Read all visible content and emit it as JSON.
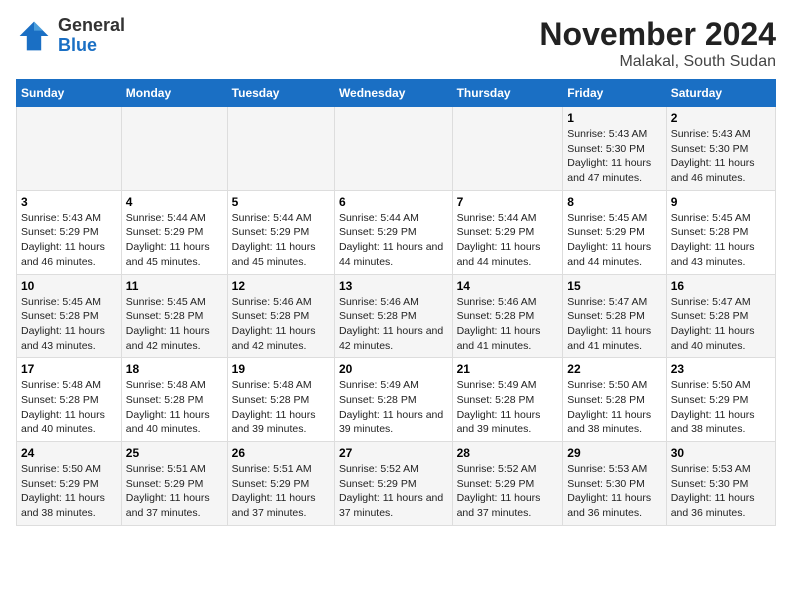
{
  "header": {
    "logo_general": "General",
    "logo_blue": "Blue",
    "title": "November 2024",
    "subtitle": "Malakal, South Sudan"
  },
  "days_of_week": [
    "Sunday",
    "Monday",
    "Tuesday",
    "Wednesday",
    "Thursday",
    "Friday",
    "Saturday"
  ],
  "weeks": [
    [
      {
        "day": "",
        "info": ""
      },
      {
        "day": "",
        "info": ""
      },
      {
        "day": "",
        "info": ""
      },
      {
        "day": "",
        "info": ""
      },
      {
        "day": "",
        "info": ""
      },
      {
        "day": "1",
        "info": "Sunrise: 5:43 AM\nSunset: 5:30 PM\nDaylight: 11 hours and 47 minutes."
      },
      {
        "day": "2",
        "info": "Sunrise: 5:43 AM\nSunset: 5:30 PM\nDaylight: 11 hours and 46 minutes."
      }
    ],
    [
      {
        "day": "3",
        "info": "Sunrise: 5:43 AM\nSunset: 5:29 PM\nDaylight: 11 hours and 46 minutes."
      },
      {
        "day": "4",
        "info": "Sunrise: 5:44 AM\nSunset: 5:29 PM\nDaylight: 11 hours and 45 minutes."
      },
      {
        "day": "5",
        "info": "Sunrise: 5:44 AM\nSunset: 5:29 PM\nDaylight: 11 hours and 45 minutes."
      },
      {
        "day": "6",
        "info": "Sunrise: 5:44 AM\nSunset: 5:29 PM\nDaylight: 11 hours and 44 minutes."
      },
      {
        "day": "7",
        "info": "Sunrise: 5:44 AM\nSunset: 5:29 PM\nDaylight: 11 hours and 44 minutes."
      },
      {
        "day": "8",
        "info": "Sunrise: 5:45 AM\nSunset: 5:29 PM\nDaylight: 11 hours and 44 minutes."
      },
      {
        "day": "9",
        "info": "Sunrise: 5:45 AM\nSunset: 5:28 PM\nDaylight: 11 hours and 43 minutes."
      }
    ],
    [
      {
        "day": "10",
        "info": "Sunrise: 5:45 AM\nSunset: 5:28 PM\nDaylight: 11 hours and 43 minutes."
      },
      {
        "day": "11",
        "info": "Sunrise: 5:45 AM\nSunset: 5:28 PM\nDaylight: 11 hours and 42 minutes."
      },
      {
        "day": "12",
        "info": "Sunrise: 5:46 AM\nSunset: 5:28 PM\nDaylight: 11 hours and 42 minutes."
      },
      {
        "day": "13",
        "info": "Sunrise: 5:46 AM\nSunset: 5:28 PM\nDaylight: 11 hours and 42 minutes."
      },
      {
        "day": "14",
        "info": "Sunrise: 5:46 AM\nSunset: 5:28 PM\nDaylight: 11 hours and 41 minutes."
      },
      {
        "day": "15",
        "info": "Sunrise: 5:47 AM\nSunset: 5:28 PM\nDaylight: 11 hours and 41 minutes."
      },
      {
        "day": "16",
        "info": "Sunrise: 5:47 AM\nSunset: 5:28 PM\nDaylight: 11 hours and 40 minutes."
      }
    ],
    [
      {
        "day": "17",
        "info": "Sunrise: 5:48 AM\nSunset: 5:28 PM\nDaylight: 11 hours and 40 minutes."
      },
      {
        "day": "18",
        "info": "Sunrise: 5:48 AM\nSunset: 5:28 PM\nDaylight: 11 hours and 40 minutes."
      },
      {
        "day": "19",
        "info": "Sunrise: 5:48 AM\nSunset: 5:28 PM\nDaylight: 11 hours and 39 minutes."
      },
      {
        "day": "20",
        "info": "Sunrise: 5:49 AM\nSunset: 5:28 PM\nDaylight: 11 hours and 39 minutes."
      },
      {
        "day": "21",
        "info": "Sunrise: 5:49 AM\nSunset: 5:28 PM\nDaylight: 11 hours and 39 minutes."
      },
      {
        "day": "22",
        "info": "Sunrise: 5:50 AM\nSunset: 5:28 PM\nDaylight: 11 hours and 38 minutes."
      },
      {
        "day": "23",
        "info": "Sunrise: 5:50 AM\nSunset: 5:29 PM\nDaylight: 11 hours and 38 minutes."
      }
    ],
    [
      {
        "day": "24",
        "info": "Sunrise: 5:50 AM\nSunset: 5:29 PM\nDaylight: 11 hours and 38 minutes."
      },
      {
        "day": "25",
        "info": "Sunrise: 5:51 AM\nSunset: 5:29 PM\nDaylight: 11 hours and 37 minutes."
      },
      {
        "day": "26",
        "info": "Sunrise: 5:51 AM\nSunset: 5:29 PM\nDaylight: 11 hours and 37 minutes."
      },
      {
        "day": "27",
        "info": "Sunrise: 5:52 AM\nSunset: 5:29 PM\nDaylight: 11 hours and 37 minutes."
      },
      {
        "day": "28",
        "info": "Sunrise: 5:52 AM\nSunset: 5:29 PM\nDaylight: 11 hours and 37 minutes."
      },
      {
        "day": "29",
        "info": "Sunrise: 5:53 AM\nSunset: 5:30 PM\nDaylight: 11 hours and 36 minutes."
      },
      {
        "day": "30",
        "info": "Sunrise: 5:53 AM\nSunset: 5:30 PM\nDaylight: 11 hours and 36 minutes."
      }
    ]
  ]
}
